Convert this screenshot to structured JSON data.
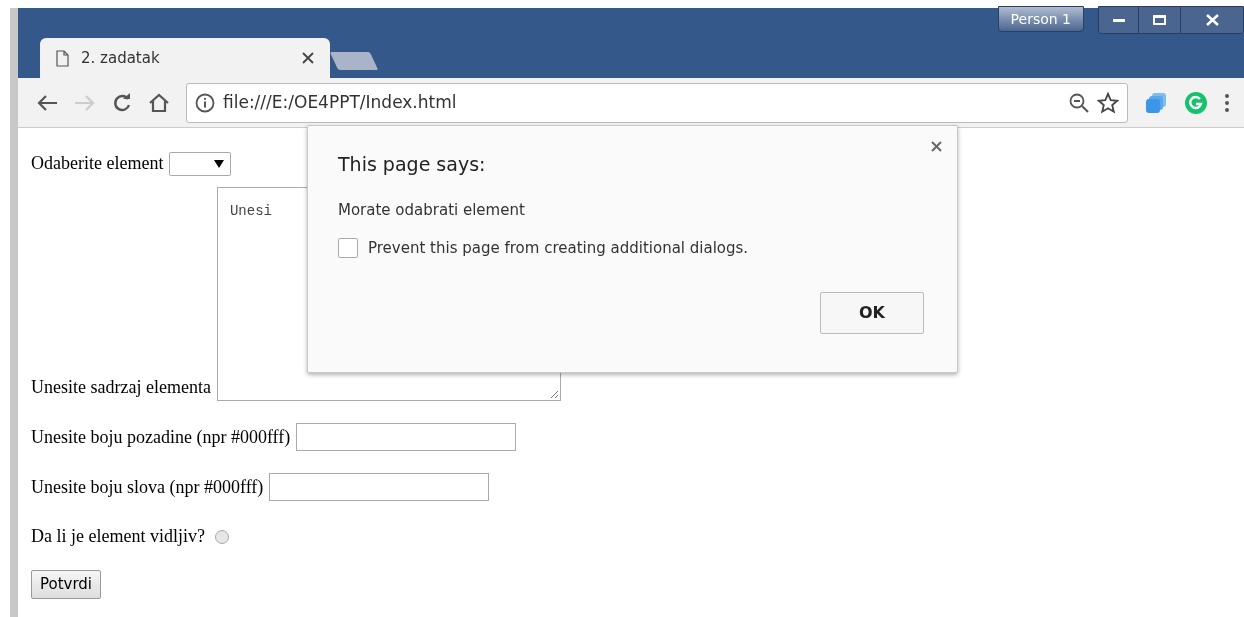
{
  "window": {
    "profile": "Person 1"
  },
  "tabs": [
    {
      "title": "2. zadatak",
      "selected": true
    }
  ],
  "toolbar": {
    "address": "file:///E:/OE4PPT/Index.html"
  },
  "form": {
    "select_label": "Odaberite element",
    "textarea_label": "Unesite sadrzaj elementa",
    "textarea_placeholder": "Unesi",
    "background_label": "Unesite boju pozadine (npr #000fff)",
    "text_color_label": "Unesite boju slova (npr #000fff)",
    "visible_label": "Da li je element vidljiv?",
    "visible_selected": false,
    "submit": "Potvrdi"
  },
  "dialog": {
    "title": "This page says:",
    "message": "Morate odabrati element",
    "checkbox_label": "Prevent this page from creating additional dialogs.",
    "checkbox_checked": false,
    "ok": "OK"
  }
}
